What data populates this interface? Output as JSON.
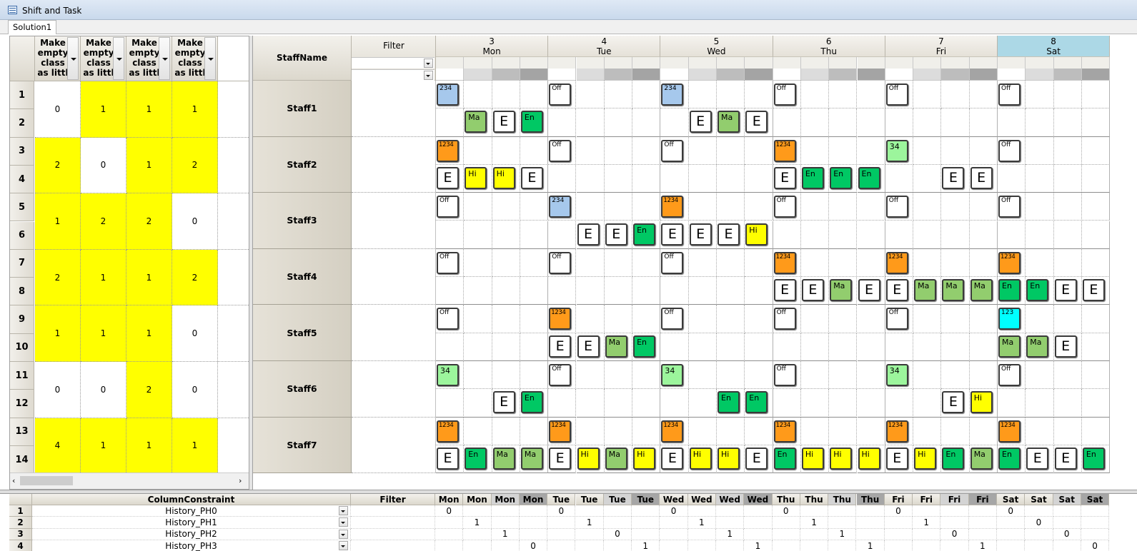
{
  "window": {
    "title": "Shift and Task",
    "tab": "Solution1"
  },
  "left_grid": {
    "header_label": "Make empty class as littl",
    "rows": [
      "1",
      "2",
      "3",
      "4",
      "5",
      "6",
      "7",
      "8",
      "9",
      "10",
      "11",
      "12",
      "13",
      "14"
    ],
    "values": [
      [
        {
          "v": "0",
          "bg": "#ffffff"
        },
        {
          "v": "1",
          "bg": "#ffff00"
        },
        {
          "v": "1",
          "bg": "#ffff00"
        },
        {
          "v": "1",
          "bg": "#ffff00"
        }
      ],
      [
        {
          "v": "2",
          "bg": "#ffff00"
        },
        {
          "v": "0",
          "bg": "#ffffff"
        },
        {
          "v": "1",
          "bg": "#ffff00"
        },
        {
          "v": "2",
          "bg": "#ffff00"
        }
      ],
      [
        {
          "v": "1",
          "bg": "#ffff00"
        },
        {
          "v": "2",
          "bg": "#ffff00"
        },
        {
          "v": "2",
          "bg": "#ffff00"
        },
        {
          "v": "0",
          "bg": "#ffffff"
        }
      ],
      [
        {
          "v": "2",
          "bg": "#ffff00"
        },
        {
          "v": "1",
          "bg": "#ffff00"
        },
        {
          "v": "1",
          "bg": "#ffff00"
        },
        {
          "v": "2",
          "bg": "#ffff00"
        }
      ],
      [
        {
          "v": "1",
          "bg": "#ffff00"
        },
        {
          "v": "1",
          "bg": "#ffff00"
        },
        {
          "v": "1",
          "bg": "#ffff00"
        },
        {
          "v": "0",
          "bg": "#ffffff"
        }
      ],
      [
        {
          "v": "0",
          "bg": "#ffffff"
        },
        {
          "v": "0",
          "bg": "#ffffff"
        },
        {
          "v": "2",
          "bg": "#ffff00"
        },
        {
          "v": "0",
          "bg": "#ffffff"
        }
      ],
      [
        {
          "v": "4",
          "bg": "#ffff00"
        },
        {
          "v": "1",
          "bg": "#ffff00"
        },
        {
          "v": "1",
          "bg": "#ffff00"
        },
        {
          "v": "1",
          "bg": "#ffff00"
        }
      ]
    ]
  },
  "schedule": {
    "staff_header": "StaffName",
    "filter_header": "Filter",
    "days": [
      {
        "num": "3",
        "name": "Mon"
      },
      {
        "num": "4",
        "name": "Tue"
      },
      {
        "num": "5",
        "name": "Wed"
      },
      {
        "num": "6",
        "name": "Thu"
      },
      {
        "num": "7",
        "name": "Fri"
      },
      {
        "num": "8",
        "name": "Sat"
      }
    ],
    "staff": [
      {
        "name": "Staff1",
        "shifts": [
          {
            "day": 0,
            "label": "234",
            "color": "#a6c8ec"
          },
          {
            "day": 1,
            "label": "Off",
            "color": "#ffffff"
          },
          {
            "day": 2,
            "label": "234",
            "color": "#a6c8ec"
          },
          {
            "day": 3,
            "label": "Off",
            "color": "#ffffff"
          },
          {
            "day": 4,
            "label": "Off",
            "color": "#ffffff"
          },
          {
            "day": 5,
            "label": "Off",
            "color": "#ffffff"
          }
        ],
        "tasks": [
          {
            "slot": 1,
            "label": "Ma",
            "color": "#92cd6e"
          },
          {
            "slot": 2,
            "label": "E",
            "color": "#ffffff"
          },
          {
            "slot": 3,
            "label": "En",
            "color": "#00c864"
          },
          {
            "slot": 9,
            "label": "E",
            "color": "#ffffff"
          },
          {
            "slot": 10,
            "label": "Ma",
            "color": "#92cd6e"
          },
          {
            "slot": 11,
            "label": "E",
            "color": "#ffffff"
          }
        ]
      },
      {
        "name": "Staff2",
        "shifts": [
          {
            "day": 0,
            "label": "1234",
            "color": "#ff9a1a"
          },
          {
            "day": 1,
            "label": "Off",
            "color": "#ffffff"
          },
          {
            "day": 2,
            "label": "Off",
            "color": "#ffffff"
          },
          {
            "day": 3,
            "label": "1234",
            "color": "#ff9a1a"
          },
          {
            "day": 4,
            "label": "34",
            "color": "#9cf59c"
          },
          {
            "day": 5,
            "label": "Off",
            "color": "#ffffff"
          }
        ],
        "tasks": [
          {
            "slot": 0,
            "label": "E",
            "color": "#ffffff"
          },
          {
            "slot": 1,
            "label": "Hi",
            "color": "#ffff00"
          },
          {
            "slot": 2,
            "label": "Hi",
            "color": "#ffff00"
          },
          {
            "slot": 3,
            "label": "E",
            "color": "#ffffff"
          },
          {
            "slot": 12,
            "label": "E",
            "color": "#ffffff"
          },
          {
            "slot": 13,
            "label": "En",
            "color": "#00c864"
          },
          {
            "slot": 14,
            "label": "En",
            "color": "#00c864"
          },
          {
            "slot": 15,
            "label": "En",
            "color": "#00c864"
          },
          {
            "slot": 18,
            "label": "E",
            "color": "#ffffff"
          },
          {
            "slot": 19,
            "label": "E",
            "color": "#ffffff"
          }
        ]
      },
      {
        "name": "Staff3",
        "shifts": [
          {
            "day": 0,
            "label": "Off",
            "color": "#ffffff"
          },
          {
            "day": 1,
            "label": "234",
            "color": "#a6c8ec"
          },
          {
            "day": 2,
            "label": "1234",
            "color": "#ff9a1a"
          },
          {
            "day": 3,
            "label": "Off",
            "color": "#ffffff"
          },
          {
            "day": 4,
            "label": "Off",
            "color": "#ffffff"
          },
          {
            "day": 5,
            "label": "Off",
            "color": "#ffffff"
          }
        ],
        "tasks": [
          {
            "slot": 5,
            "label": "E",
            "color": "#ffffff"
          },
          {
            "slot": 6,
            "label": "E",
            "color": "#ffffff"
          },
          {
            "slot": 7,
            "label": "En",
            "color": "#00c864"
          },
          {
            "slot": 8,
            "label": "E",
            "color": "#ffffff"
          },
          {
            "slot": 9,
            "label": "E",
            "color": "#ffffff"
          },
          {
            "slot": 10,
            "label": "E",
            "color": "#ffffff"
          },
          {
            "slot": 11,
            "label": "Hi",
            "color": "#ffff00"
          }
        ]
      },
      {
        "name": "Staff4",
        "shifts": [
          {
            "day": 0,
            "label": "Off",
            "color": "#ffffff"
          },
          {
            "day": 1,
            "label": "Off",
            "color": "#ffffff"
          },
          {
            "day": 2,
            "label": "Off",
            "color": "#ffffff"
          },
          {
            "day": 3,
            "label": "1234",
            "color": "#ff9a1a"
          },
          {
            "day": 4,
            "label": "1234",
            "color": "#ff9a1a"
          },
          {
            "day": 5,
            "label": "1234",
            "color": "#ff9a1a"
          }
        ],
        "tasks": [
          {
            "slot": 12,
            "label": "E",
            "color": "#ffffff"
          },
          {
            "slot": 13,
            "label": "E",
            "color": "#ffffff"
          },
          {
            "slot": 14,
            "label": "Ma",
            "color": "#92cd6e"
          },
          {
            "slot": 15,
            "label": "E",
            "color": "#ffffff"
          },
          {
            "slot": 16,
            "label": "E",
            "color": "#ffffff"
          },
          {
            "slot": 17,
            "label": "Ma",
            "color": "#92cd6e"
          },
          {
            "slot": 18,
            "label": "Ma",
            "color": "#92cd6e"
          },
          {
            "slot": 19,
            "label": "Ma",
            "color": "#92cd6e"
          },
          {
            "slot": 20,
            "label": "En",
            "color": "#00c864"
          },
          {
            "slot": 21,
            "label": "En",
            "color": "#00c864"
          },
          {
            "slot": 22,
            "label": "E",
            "color": "#ffffff"
          },
          {
            "slot": 23,
            "label": "E",
            "color": "#ffffff"
          }
        ]
      },
      {
        "name": "Staff5",
        "shifts": [
          {
            "day": 0,
            "label": "Off",
            "color": "#ffffff"
          },
          {
            "day": 1,
            "label": "1234",
            "color": "#ff9a1a"
          },
          {
            "day": 2,
            "label": "Off",
            "color": "#ffffff"
          },
          {
            "day": 3,
            "label": "Off",
            "color": "#ffffff"
          },
          {
            "day": 4,
            "label": "Off",
            "color": "#ffffff"
          },
          {
            "day": 5,
            "label": "123",
            "color": "#00ffff"
          }
        ],
        "tasks": [
          {
            "slot": 4,
            "label": "E",
            "color": "#ffffff"
          },
          {
            "slot": 5,
            "label": "E",
            "color": "#ffffff"
          },
          {
            "slot": 6,
            "label": "Ma",
            "color": "#92cd6e"
          },
          {
            "slot": 7,
            "label": "En",
            "color": "#00c864"
          },
          {
            "slot": 20,
            "label": "Ma",
            "color": "#92cd6e"
          },
          {
            "slot": 21,
            "label": "Ma",
            "color": "#92cd6e"
          },
          {
            "slot": 22,
            "label": "E",
            "color": "#ffffff"
          }
        ]
      },
      {
        "name": "Staff6",
        "shifts": [
          {
            "day": 0,
            "label": "34",
            "color": "#9cf59c"
          },
          {
            "day": 1,
            "label": "Off",
            "color": "#ffffff"
          },
          {
            "day": 2,
            "label": "34",
            "color": "#9cf59c"
          },
          {
            "day": 3,
            "label": "Off",
            "color": "#ffffff"
          },
          {
            "day": 4,
            "label": "34",
            "color": "#9cf59c"
          },
          {
            "day": 5,
            "label": "Off",
            "color": "#ffffff"
          }
        ],
        "tasks": [
          {
            "slot": 2,
            "label": "E",
            "color": "#ffffff"
          },
          {
            "slot": 3,
            "label": "En",
            "color": "#00c864"
          },
          {
            "slot": 10,
            "label": "En",
            "color": "#00c864"
          },
          {
            "slot": 11,
            "label": "En",
            "color": "#00c864"
          },
          {
            "slot": 18,
            "label": "E",
            "color": "#ffffff"
          },
          {
            "slot": 19,
            "label": "Hi",
            "color": "#ffff00"
          }
        ]
      },
      {
        "name": "Staff7",
        "shifts": [
          {
            "day": 0,
            "label": "1234",
            "color": "#ff9a1a"
          },
          {
            "day": 1,
            "label": "1234",
            "color": "#ff9a1a"
          },
          {
            "day": 2,
            "label": "1234",
            "color": "#ff9a1a"
          },
          {
            "day": 3,
            "label": "1234",
            "color": "#ff9a1a"
          },
          {
            "day": 4,
            "label": "1234",
            "color": "#ff9a1a"
          },
          {
            "day": 5,
            "label": "1234",
            "color": "#ff9a1a"
          }
        ],
        "tasks": [
          {
            "slot": 0,
            "label": "E",
            "color": "#ffffff"
          },
          {
            "slot": 1,
            "label": "En",
            "color": "#00c864"
          },
          {
            "slot": 2,
            "label": "Ma",
            "color": "#92cd6e"
          },
          {
            "slot": 3,
            "label": "Ma",
            "color": "#92cd6e"
          },
          {
            "slot": 4,
            "label": "E",
            "color": "#ffffff"
          },
          {
            "slot": 5,
            "label": "Hi",
            "color": "#ffff00"
          },
          {
            "slot": 6,
            "label": "Ma",
            "color": "#92cd6e"
          },
          {
            "slot": 7,
            "label": "Hi",
            "color": "#ffff00"
          },
          {
            "slot": 8,
            "label": "E",
            "color": "#ffffff"
          },
          {
            "slot": 9,
            "label": "Hi",
            "color": "#ffff00"
          },
          {
            "slot": 10,
            "label": "Hi",
            "color": "#ffff00"
          },
          {
            "slot": 11,
            "label": "E",
            "color": "#ffffff"
          },
          {
            "slot": 12,
            "label": "En",
            "color": "#00c864"
          },
          {
            "slot": 13,
            "label": "Hi",
            "color": "#ffff00"
          },
          {
            "slot": 14,
            "label": "Hi",
            "color": "#ffff00"
          },
          {
            "slot": 15,
            "label": "Hi",
            "color": "#ffff00"
          },
          {
            "slot": 16,
            "label": "E",
            "color": "#ffffff"
          },
          {
            "slot": 17,
            "label": "Hi",
            "color": "#ffff00"
          },
          {
            "slot": 18,
            "label": "En",
            "color": "#00c864"
          },
          {
            "slot": 19,
            "label": "Ma",
            "color": "#92cd6e"
          },
          {
            "slot": 20,
            "label": "En",
            "color": "#00c864"
          },
          {
            "slot": 21,
            "label": "E",
            "color": "#ffffff"
          },
          {
            "slot": 22,
            "label": "E",
            "color": "#ffffff"
          },
          {
            "slot": 23,
            "label": "En",
            "color": "#00c864"
          }
        ]
      }
    ]
  },
  "bottom_grid": {
    "constraint_header": "ColumnConstraint",
    "filter_header": "Filter",
    "col_days": [
      "Mon",
      "Mon",
      "Mon",
      "Mon",
      "Tue",
      "Tue",
      "Tue",
      "Tue",
      "Wed",
      "Wed",
      "Wed",
      "Wed",
      "Thu",
      "Thu",
      "Thu",
      "Thu",
      "Fri",
      "Fri",
      "Fri",
      "Fri",
      "Sat",
      "Sat",
      "Sat",
      "Sat"
    ],
    "rows": [
      {
        "no": "1",
        "name": "History_PH0",
        "cells": [
          "0",
          "",
          "",
          "",
          "0",
          "",
          "",
          "",
          "0",
          "",
          "",
          "",
          "0",
          "",
          "",
          "",
          "0",
          "",
          "",
          "",
          "0",
          "",
          "",
          ""
        ]
      },
      {
        "no": "2",
        "name": "History_PH1",
        "cells": [
          "",
          "1",
          "",
          "",
          "",
          "1",
          "",
          "",
          "",
          "1",
          "",
          "",
          "",
          "1",
          "",
          "",
          "",
          "1",
          "",
          "",
          "",
          "0",
          "",
          ""
        ]
      },
      {
        "no": "3",
        "name": "History_PH2",
        "cells": [
          "",
          "",
          "1",
          "",
          "",
          "",
          "0",
          "",
          "",
          "",
          "1",
          "",
          "",
          "",
          "1",
          "",
          "",
          "",
          "0",
          "",
          "",
          "",
          "0",
          ""
        ]
      },
      {
        "no": "4",
        "name": "History_PH3",
        "cells": [
          "",
          "",
          "",
          "0",
          "",
          "",
          "",
          "1",
          "",
          "",
          "",
          "1",
          "",
          "",
          "",
          "1",
          "",
          "",
          "",
          "1",
          "",
          "",
          "",
          "0"
        ]
      }
    ]
  }
}
